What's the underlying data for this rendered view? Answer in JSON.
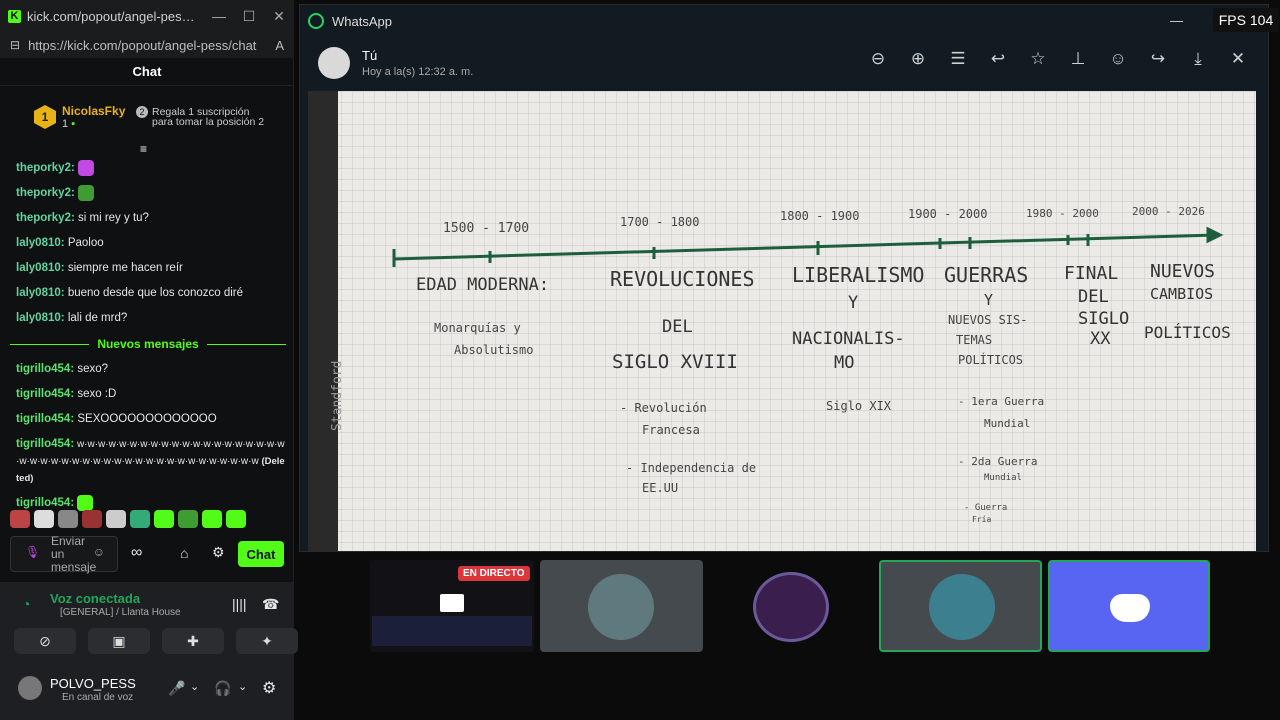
{
  "kick": {
    "tab_title": "kick.com/popout/angel-pes…",
    "url": "https://kick.com/popout/angel-pess/chat",
    "chat_title": "Chat",
    "leader": {
      "rank": "1",
      "name": "NicolasFky",
      "count": "1",
      "rank2": "2",
      "gift_text": "Regala 1 suscripción para tomar la posición 2"
    },
    "messages": [
      {
        "user": "theporky2:",
        "text": ""
      },
      {
        "user": "theporky2:",
        "text": ""
      },
      {
        "user": "theporky2:",
        "text": "si mi rey y tu?"
      },
      {
        "user": "laly0810:",
        "text": "Paoloo"
      },
      {
        "user": "laly0810:",
        "text": "siempre me hacen reír"
      },
      {
        "user": "laly0810:",
        "text": "bueno desde que los conozco diré"
      },
      {
        "user": "laly0810:",
        "text": "lali de mrd?"
      }
    ],
    "new_messages_label": "Nuevos mensajes",
    "new_messages": [
      {
        "user": "tigrillo454:",
        "text": "sexo?"
      },
      {
        "user": "tigrillo454:",
        "text": "sexo :D"
      },
      {
        "user": "tigrillo454:",
        "text": "SEXOOOOOOOOOOOOO"
      },
      {
        "user": "tigrillo454:",
        "text": "w·w·w·w·w·w·w·w·w·w·w·w·w·w·w·w·w·w·w·w·w·w·w·w·w·w·w·w·w·w·w·w·w·w·w·w·w·w·w·w·w·w·w",
        "deleted": "(Deleted)"
      },
      {
        "user": "tigrillo454:",
        "text": ""
      }
    ],
    "input_placeholder": "Enviar un mensaje",
    "chat_button": "Chat"
  },
  "discord": {
    "voice_status": "Voz conectada",
    "voice_channel": "[GENERAL] / Llanta House",
    "username": "POLVO_PESS",
    "user_status": "En canal de voz"
  },
  "whatsapp": {
    "app_title": "WhatsApp",
    "sender": "Tú",
    "timestamp": "Hoy a la(s) 12:32 a. m.",
    "notebook": {
      "periods": [
        "1500 - 1700",
        "1700 - 1800",
        "1800 - 1900",
        "1900 - 2000",
        "1980 - 2000",
        "2000 - 2026"
      ],
      "col1": [
        "EDAD MODERNA:",
        "Monarquías y",
        "Absolutismo"
      ],
      "col2": [
        "REVOLUCIONES",
        "DEL",
        "SIGLO XVIII",
        "- Revolución",
        "Francesa",
        "- Independencia de",
        "EE.UU"
      ],
      "col3": [
        "LIBERALISMO",
        "Y",
        "NACIONALIS-",
        "MO",
        "Siglo XIX"
      ],
      "col4": [
        "GUERRAS",
        "Y",
        "NUEVOS SIS-",
        "TEMAS",
        "POLÍTICOS",
        "- 1era Guerra",
        "Mundial",
        "- 2da Guerra",
        "Mundial",
        "- Guerra",
        "Fría"
      ],
      "col5": [
        "FINAL",
        "DEL",
        "SIGLO",
        "XX"
      ],
      "col6": [
        "NUEVOS",
        "CAMBIOS",
        "POLÍTICOS"
      ],
      "brand": "Standford"
    }
  },
  "overlay": {
    "fps": "FPS 104"
  },
  "thumbs": {
    "live_label": "EN DIRECTO"
  },
  "colors": {
    "kick_green": "#53fc18",
    "discord_blurple": "#5865f2",
    "whatsapp_bg": "#111b21"
  }
}
